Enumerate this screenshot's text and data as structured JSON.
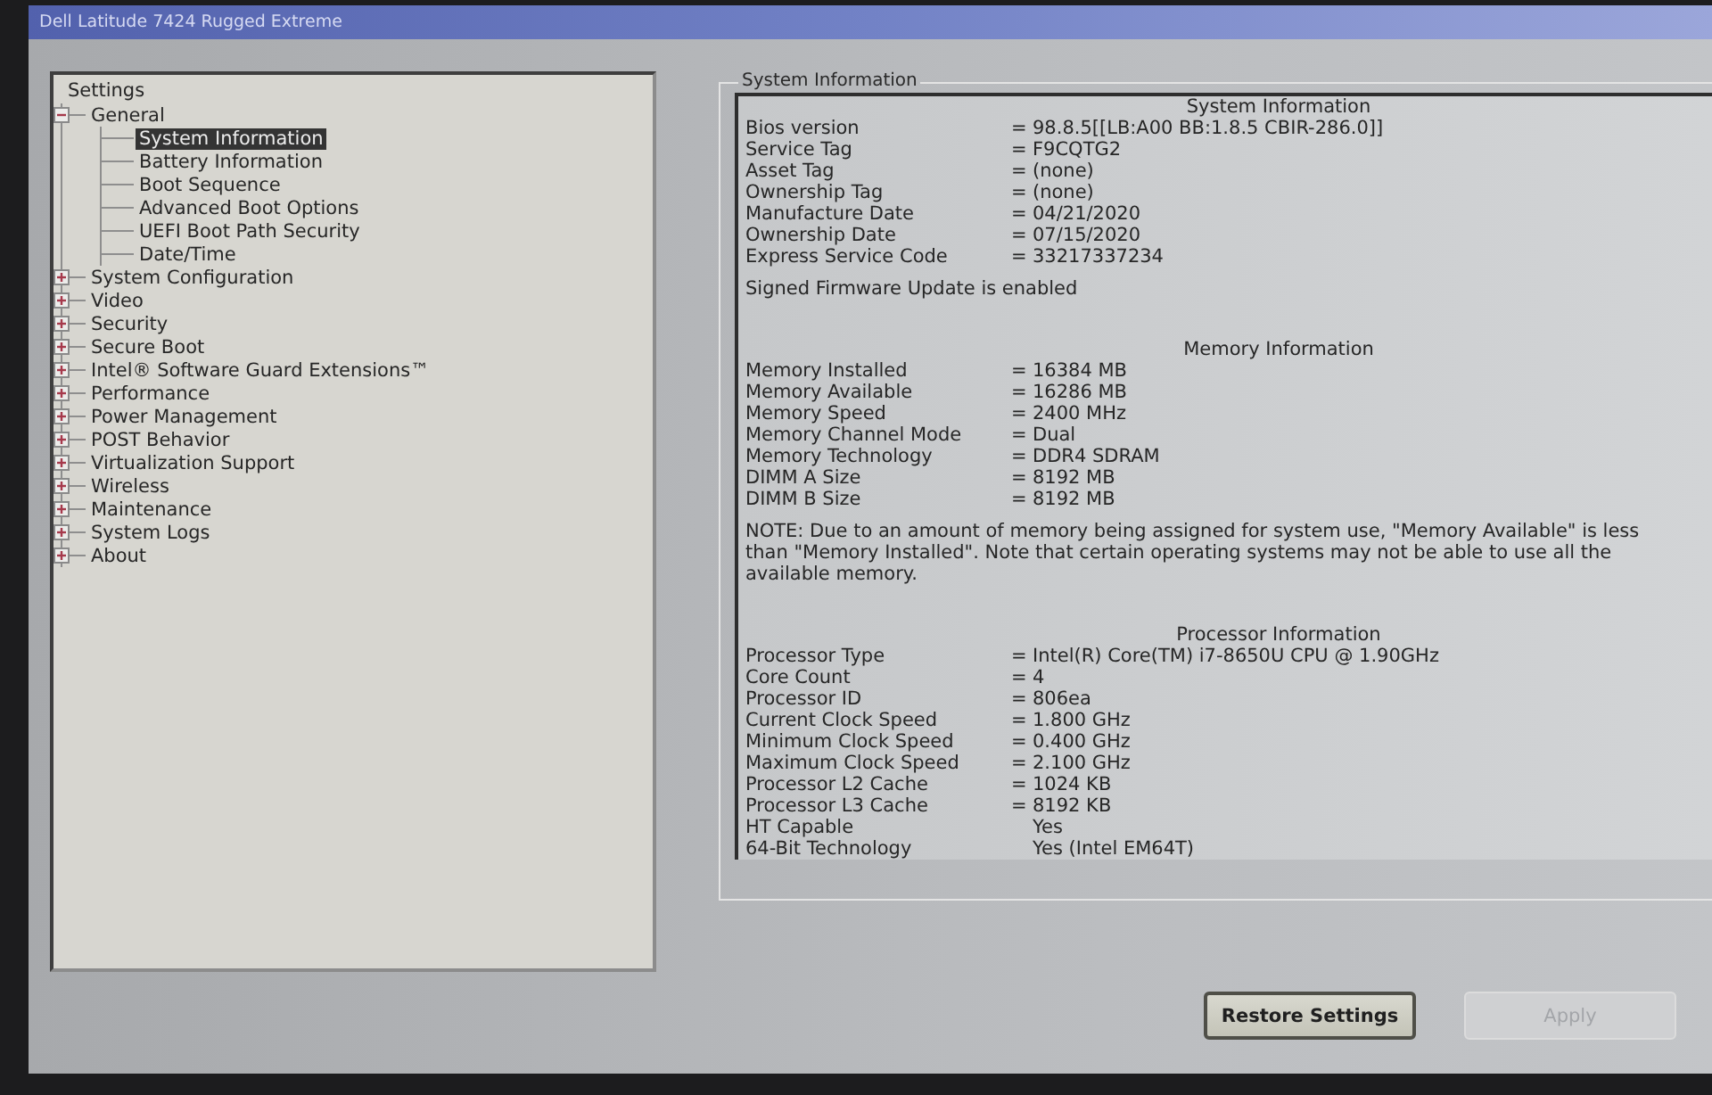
{
  "window": {
    "title": "Dell Latitude 7424 Rugged Extreme"
  },
  "tree": {
    "root": "Settings",
    "items": [
      {
        "label": "General",
        "expanded": true,
        "selected": false,
        "children": [
          {
            "label": "System Information",
            "selected": true
          },
          {
            "label": "Battery Information",
            "selected": false
          },
          {
            "label": "Boot Sequence",
            "selected": false
          },
          {
            "label": "Advanced Boot Options",
            "selected": false
          },
          {
            "label": "UEFI Boot Path Security",
            "selected": false
          },
          {
            "label": "Date/Time",
            "selected": false
          }
        ]
      },
      {
        "label": "System Configuration",
        "expanded": false,
        "selected": false
      },
      {
        "label": "Video",
        "expanded": false,
        "selected": false
      },
      {
        "label": "Security",
        "expanded": false,
        "selected": false
      },
      {
        "label": "Secure Boot",
        "expanded": false,
        "selected": false
      },
      {
        "label": "Intel® Software Guard Extensions™",
        "expanded": false,
        "selected": false
      },
      {
        "label": "Performance",
        "expanded": false,
        "selected": false
      },
      {
        "label": "Power Management",
        "expanded": false,
        "selected": false
      },
      {
        "label": "POST Behavior",
        "expanded": false,
        "selected": false
      },
      {
        "label": "Virtualization Support",
        "expanded": false,
        "selected": false
      },
      {
        "label": "Wireless",
        "expanded": false,
        "selected": false
      },
      {
        "label": "Maintenance",
        "expanded": false,
        "selected": false
      },
      {
        "label": "System Logs",
        "expanded": false,
        "selected": false
      },
      {
        "label": "About",
        "expanded": false,
        "selected": false
      }
    ]
  },
  "panel": {
    "title": "System Information",
    "sections": [
      {
        "heading": "System Information",
        "rows": [
          {
            "label": "Bios version",
            "sign": "=",
            "value": "98.8.5[[LB:A00 BB:1.8.5 CBIR-286.0]]"
          },
          {
            "label": "Service Tag",
            "sign": "=",
            "value": "F9CQTG2"
          },
          {
            "label": "Asset Tag",
            "sign": "=",
            "value": "(none)"
          },
          {
            "label": "Ownership Tag",
            "sign": "=",
            "value": "(none)"
          },
          {
            "label": "Manufacture Date",
            "sign": "=",
            "value": "04/21/2020"
          },
          {
            "label": "Ownership Date",
            "sign": "=",
            "value": "07/15/2020"
          },
          {
            "label": "Express Service Code",
            "sign": "=",
            "value": "33217337234"
          }
        ],
        "notes": [
          "Signed Firmware Update is enabled"
        ]
      },
      {
        "heading": "Memory Information",
        "rows": [
          {
            "label": "Memory Installed",
            "sign": "=",
            "value": "16384 MB"
          },
          {
            "label": "Memory Available",
            "sign": "=",
            "value": "16286 MB"
          },
          {
            "label": "Memory Speed",
            "sign": "=",
            "value": "2400 MHz"
          },
          {
            "label": "Memory Channel Mode",
            "sign": "=",
            "value": "Dual"
          },
          {
            "label": "Memory Technology",
            "sign": "=",
            "value": "DDR4 SDRAM"
          },
          {
            "label": "DIMM A Size",
            "sign": "=",
            "value": "8192 MB"
          },
          {
            "label": "DIMM B Size",
            "sign": "=",
            "value": "8192 MB"
          }
        ],
        "notes": [
          "NOTE: Due to an amount of memory being assigned for system use, \"Memory Available\" is less than \"Memory Installed\". Note that certain operating systems may not be able to use all the available memory."
        ]
      },
      {
        "heading": "Processor Information",
        "rows": [
          {
            "label": "Processor Type",
            "sign": "=",
            "value": "Intel(R) Core(TM) i7-8650U CPU @ 1.90GHz"
          },
          {
            "label": "Core Count",
            "sign": "=",
            "value": "4"
          },
          {
            "label": "Processor ID",
            "sign": "=",
            "value": "806ea"
          },
          {
            "label": "Current Clock Speed",
            "sign": "=",
            "value": "1.800 GHz"
          },
          {
            "label": "Minimum Clock Speed",
            "sign": "=",
            "value": "0.400 GHz"
          },
          {
            "label": "Maximum Clock Speed",
            "sign": "=",
            "value": "2.100 GHz"
          },
          {
            "label": "Processor L2 Cache",
            "sign": "=",
            "value": "1024 KB"
          },
          {
            "label": "Processor L3 Cache",
            "sign": "=",
            "value": "8192 KB"
          },
          {
            "label": "HT Capable",
            "value": "Yes"
          },
          {
            "label": "64-Bit Technology",
            "value": "Yes (Intel EM64T)"
          }
        ]
      }
    ]
  },
  "buttons": [
    {
      "label": "Restore Settings",
      "disabled": false
    },
    {
      "label": "Apply",
      "disabled": true
    }
  ]
}
